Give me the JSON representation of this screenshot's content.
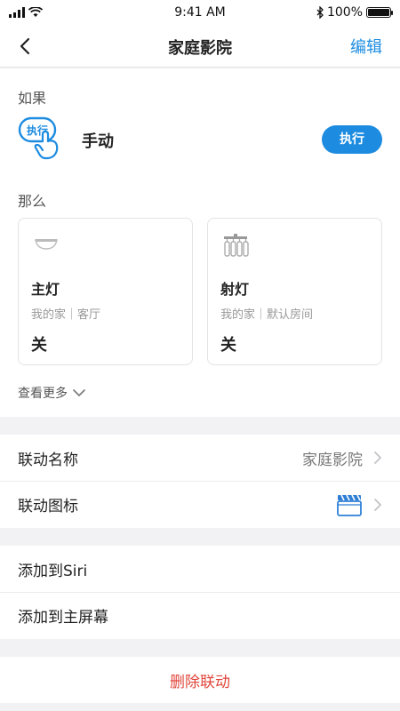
{
  "status_bar": {
    "time": "9:41 AM",
    "battery": "100%",
    "icons": [
      "signal-icon",
      "wifi-icon",
      "bluetooth-icon",
      "battery-icon"
    ]
  },
  "nav": {
    "title": "家庭影院",
    "edit_label": "编辑",
    "back_icon": "chevron-left-icon"
  },
  "if_section": {
    "label": "如果",
    "trigger": {
      "icon_text": "执行",
      "name": "手动",
      "button_label": "执行"
    }
  },
  "then_section": {
    "label": "那么",
    "devices": [
      {
        "name": "主灯",
        "location": "我的家｜客厅",
        "state": "关",
        "icon": "ceiling-light-icon"
      },
      {
        "name": "射灯",
        "location": "我的家｜默认房间",
        "state": "关",
        "icon": "spotlight-icon"
      }
    ],
    "see_more_label": "查看更多"
  },
  "settings": {
    "name_row": {
      "label": "联动名称",
      "value": "家庭影院"
    },
    "icon_row": {
      "label": "联动图标",
      "icon": "clapperboard-icon"
    },
    "siri_row": {
      "label": "添加到Siri"
    },
    "home_row": {
      "label": "添加到主屏幕"
    },
    "delete_label": "删除联动"
  },
  "colors": {
    "accent": "#1d8ce0",
    "danger": "#e0463b",
    "background": "#f2f2f4"
  }
}
